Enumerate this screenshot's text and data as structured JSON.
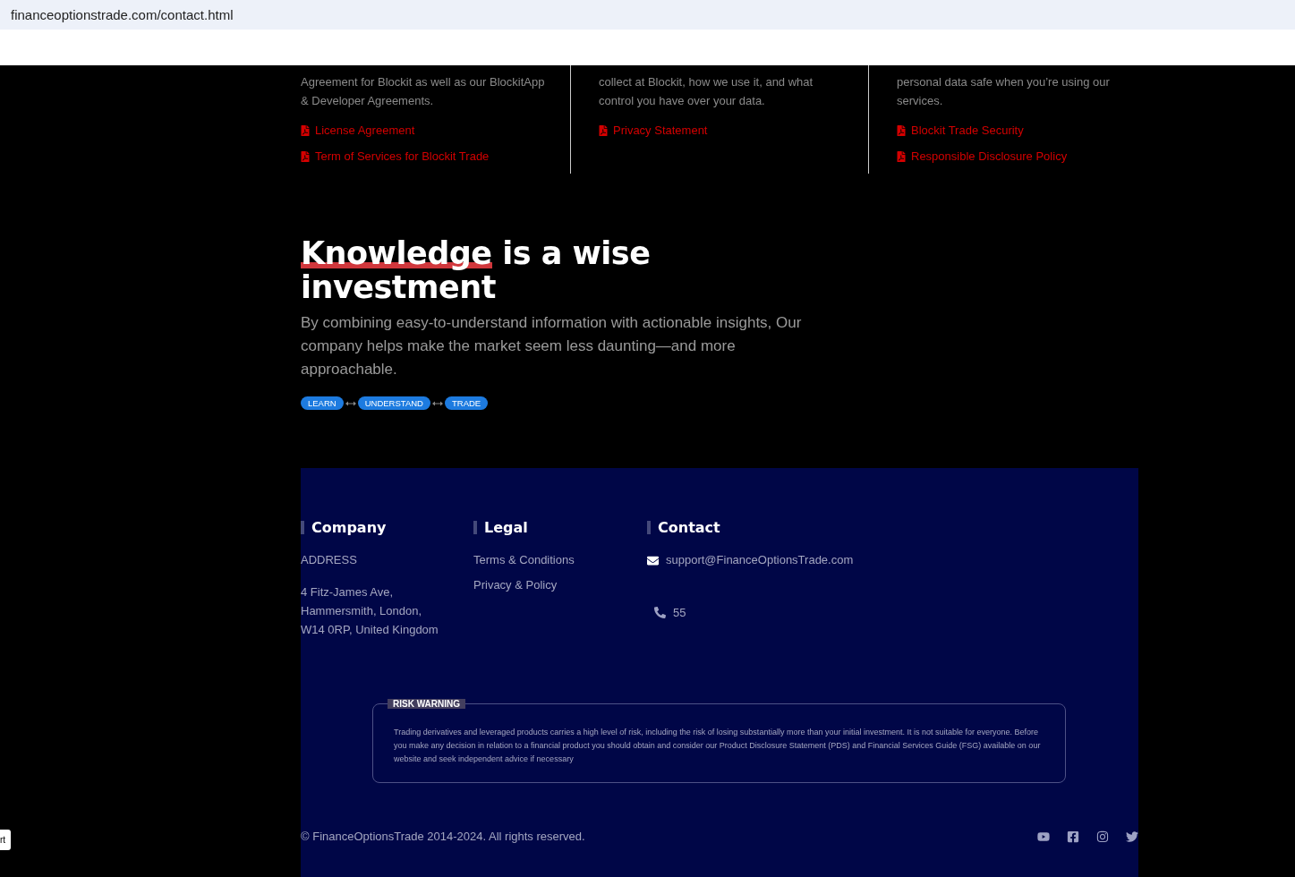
{
  "address_bar": {
    "url": "financeoptionstrade.com/contact.html"
  },
  "info_columns": [
    {
      "lines": [
        "Agreement for Blockit as well as our BlockitApp",
        "& Developer Agreements."
      ],
      "links": [
        "License Agreement",
        "Term of Services for Blockit Trade"
      ]
    },
    {
      "lines": [
        "collect at Blockit, how we use it, and what",
        "control you have over your data."
      ],
      "links": [
        "Privacy Statement"
      ]
    },
    {
      "lines": [
        "personal data safe when you’re using our",
        "services."
      ],
      "links": [
        "Blockit Trade Security",
        "Responsible Disclosure Policy"
      ]
    }
  ],
  "hero": {
    "heading_highlight": "Knowledge",
    "heading_rest": " is a wise investment",
    "text": "By combining easy-to-understand information with actionable insights, Our company helps make the market seem less daunting—and more approachable.",
    "steps": [
      "LEARN",
      "UNDERSTAND",
      "TRADE"
    ]
  },
  "footer": {
    "company": {
      "title": "Company",
      "label": "ADDRESS",
      "address": [
        "4 Fitz-James Ave,",
        "Hammersmith, London,",
        "W14 0RP, United Kingdom"
      ]
    },
    "legal": {
      "title": "Legal",
      "links": [
        "Terms & Conditions",
        "Privacy & Policy"
      ]
    },
    "contact": {
      "title": "Contact",
      "email": "support@FinanceOptionsTrade.com",
      "phone": "55"
    },
    "risk_warning": {
      "title": "RISK WARNING",
      "text": "Trading derivatives and leveraged products carries a high level of risk, including the risk of losing substantially more than your initial investment. It is not suitable for everyone. Before you make any decision in relation to a financial product you should obtain and consider our Product Disclosure Statement (PDS) and Financial Services Guide (FSG) available on our website and seek independent advice if necessary"
    },
    "copyright": "© FinanceOptionsTrade 2014-2024. All rights reserved.",
    "socials": [
      {
        "kind": "youtube"
      },
      {
        "kind": "facebook"
      },
      {
        "kind": "instagram"
      },
      {
        "kind": "twitter"
      }
    ]
  },
  "side_tab": {
    "label": "rt"
  }
}
